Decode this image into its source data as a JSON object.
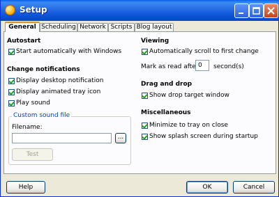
{
  "window": {
    "title": "Setup"
  },
  "tabs": [
    "General",
    "Scheduling",
    "Network",
    "Scripts",
    "Blog layout"
  ],
  "autostart": {
    "heading": "Autostart",
    "start_with_windows": {
      "label": "Start automatically with Windows",
      "checked": true
    }
  },
  "notifications": {
    "heading": "Change notifications",
    "items": [
      {
        "label": "Display desktop notification",
        "checked": true
      },
      {
        "label": "Display animated tray icon",
        "checked": true
      },
      {
        "label": "Play sound",
        "checked": true
      }
    ],
    "sound_group": {
      "legend": "Custom sound file",
      "filename_label": "Filename:",
      "filename_value": "",
      "browse_label": "...",
      "test_label": "Test"
    }
  },
  "viewing": {
    "heading": "Viewing",
    "auto_scroll": {
      "label": "Automatically scroll to first change",
      "checked": true
    },
    "mark_read_prefix": "Mark as read after",
    "mark_read_value": "0",
    "mark_read_suffix": "second(s)"
  },
  "dragdrop": {
    "heading": "Drag and drop",
    "show_target": {
      "label": "Show drop target window",
      "checked": true
    }
  },
  "misc": {
    "heading": "Miscellaneous",
    "items": [
      {
        "label": "Minimize to tray on close",
        "checked": true
      },
      {
        "label": "Show splash screen during startup",
        "checked": true
      }
    ]
  },
  "buttons": {
    "help": "Help",
    "ok": "OK",
    "cancel": "Cancel"
  }
}
